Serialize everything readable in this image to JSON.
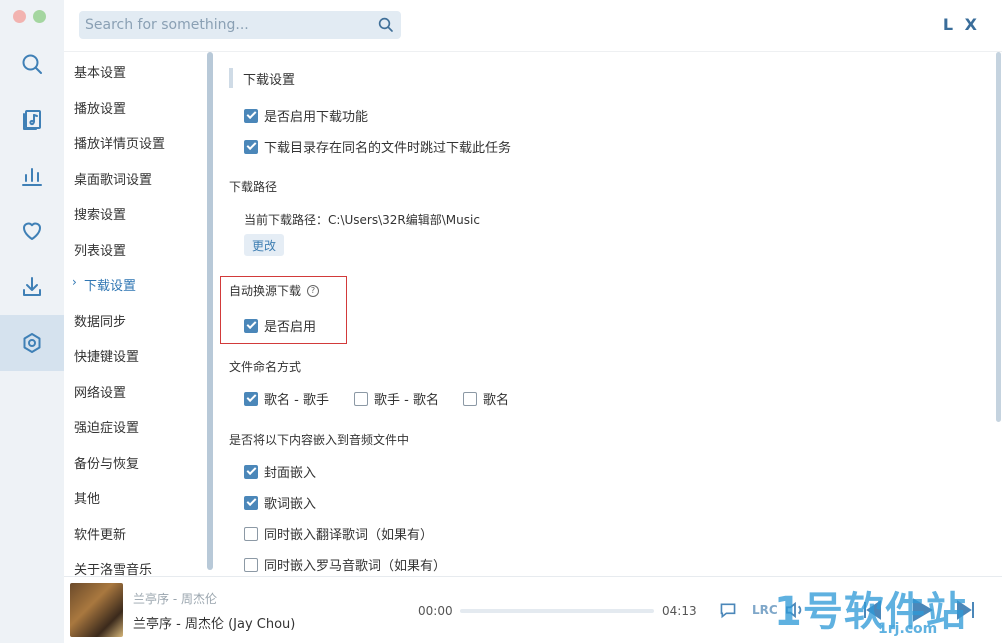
{
  "search": {
    "placeholder": "Search for something..."
  },
  "brand": "L X",
  "nav": {
    "items": [
      {
        "label": "基本设置"
      },
      {
        "label": "播放设置"
      },
      {
        "label": "播放详情页设置"
      },
      {
        "label": "桌面歌词设置"
      },
      {
        "label": "搜索设置"
      },
      {
        "label": "列表设置"
      },
      {
        "label": "下载设置",
        "active": true
      },
      {
        "label": "数据同步"
      },
      {
        "label": "快捷键设置"
      },
      {
        "label": "网络设置"
      },
      {
        "label": "强迫症设置"
      },
      {
        "label": "备份与恢复"
      },
      {
        "label": "其他"
      },
      {
        "label": "软件更新"
      },
      {
        "label": "关于洛雪音乐"
      }
    ],
    "active_marker": "›"
  },
  "download": {
    "section_title": "下载设置",
    "enable_download": {
      "label": "是否启用下载功能",
      "checked": true
    },
    "skip_existing": {
      "label": "下载目录存在同名的文件时跳过下载此任务",
      "checked": true
    },
    "path_heading": "下载路径",
    "current_path_label": "当前下载路径：",
    "current_path_value": "C:\\Users\\32R编辑部\\Music",
    "change_button": "更改",
    "auto_switch_heading": "自动换源下载",
    "auto_switch_help": "?",
    "auto_switch_enable": {
      "label": "是否启用",
      "checked": true
    },
    "naming_heading": "文件命名方式",
    "naming_options": [
      {
        "label": "歌名 - 歌手",
        "checked": true
      },
      {
        "label": "歌手 - 歌名",
        "checked": false
      },
      {
        "label": "歌名",
        "checked": false
      }
    ],
    "embed_heading": "是否将以下内容嵌入到音频文件中",
    "embed_options": [
      {
        "label": "封面嵌入",
        "checked": true
      },
      {
        "label": "歌词嵌入",
        "checked": true
      },
      {
        "label": "同时嵌入翻译歌词（如果有）",
        "checked": false
      },
      {
        "label": "同时嵌入罗马音歌词（如果有）",
        "checked": false
      }
    ]
  },
  "player": {
    "sub_title": "兰亭序 - 周杰伦",
    "title": "兰亭序 - 周杰伦 (Jay Chou)",
    "current_time": "00:00",
    "total_time": "04:13",
    "progress": 0,
    "lrc_label": "LRC"
  },
  "watermark": {
    "big": "1号软件站",
    "small": "1rj.com"
  },
  "colors": {
    "accent": "#4b87b9",
    "rail_bg": "#eef2f6",
    "highlight": "#d23a3a"
  },
  "icons": {
    "rail": [
      "search-icon",
      "music-list-icon",
      "leaderboard-icon",
      "heart-icon",
      "download-icon",
      "settings-icon"
    ]
  }
}
